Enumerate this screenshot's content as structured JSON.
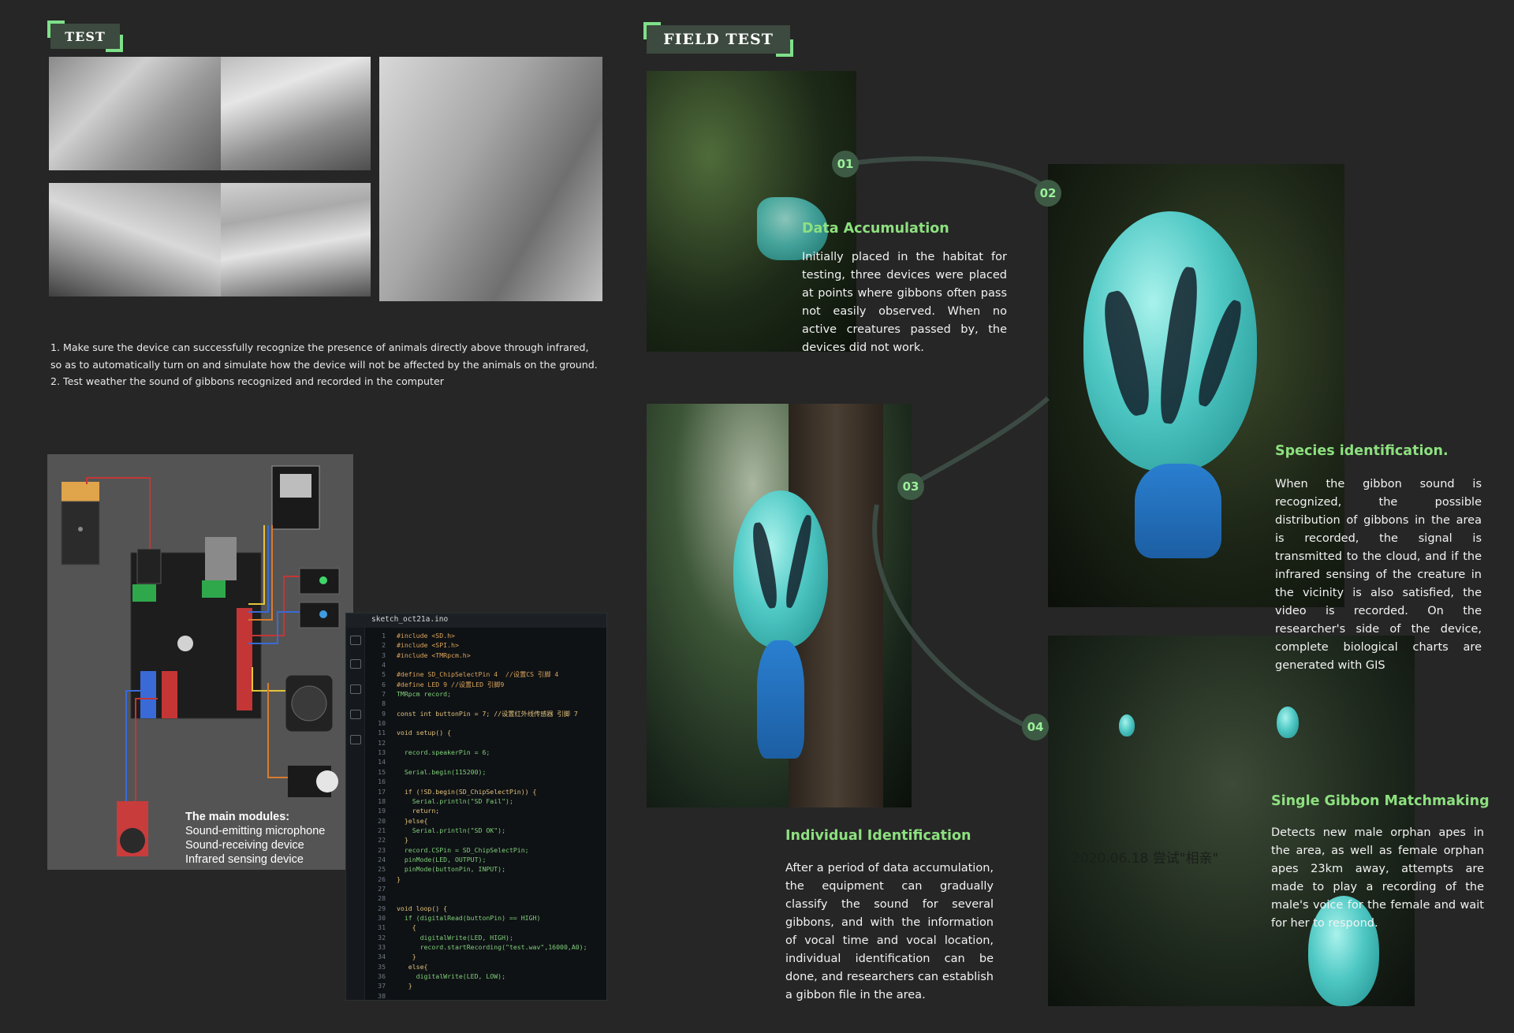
{
  "test_section": {
    "tag": "TEST",
    "notes": [
      "1. Make sure the device can successfully recognize the presence of animals directly above through infrared, so as to automatically turn on and simulate how the device will not be affected by the animals on the ground.",
      "2. Test weather the sound of gibbons recognized and recorded in the computer"
    ],
    "modules_title": "The main modules:",
    "modules": [
      "Sound-emitting microphone",
      "Sound-receiving device",
      "Infrared sensing device"
    ]
  },
  "code_editor": {
    "filename": "sketch_oct21a.ino",
    "lines": [
      {
        "n": "1",
        "t": "#include <SD.h>"
      },
      {
        "n": "2",
        "t": "#include <SPI.h>"
      },
      {
        "n": "3",
        "t": "#include <TMRpcm.h>"
      },
      {
        "n": "4",
        "t": ""
      },
      {
        "n": "5",
        "t": "#define SD_ChipSelectPin 4  //设置CS 引脚 4"
      },
      {
        "n": "6",
        "t": "#define LED 9 //设置LED 引脚9"
      },
      {
        "n": "7",
        "t": "TMRpcm record;"
      },
      {
        "n": "8",
        "t": ""
      },
      {
        "n": "9",
        "t": "const int buttonPin = 7; //设置红外线传感器 引脚 7"
      },
      {
        "n": "10",
        "t": ""
      },
      {
        "n": "11",
        "t": "void setup() {"
      },
      {
        "n": "12",
        "t": ""
      },
      {
        "n": "13",
        "t": "  record.speakerPin = 6;"
      },
      {
        "n": "14",
        "t": ""
      },
      {
        "n": "15",
        "t": "  Serial.begin(115200);"
      },
      {
        "n": "16",
        "t": ""
      },
      {
        "n": "17",
        "t": "  if (!SD.begin(SD_ChipSelectPin)) {"
      },
      {
        "n": "18",
        "t": "    Serial.println(\"SD Fail\");"
      },
      {
        "n": "19",
        "t": "    return;"
      },
      {
        "n": "20",
        "t": "  }else{"
      },
      {
        "n": "21",
        "t": "    Serial.println(\"SD OK\");"
      },
      {
        "n": "22",
        "t": "  }"
      },
      {
        "n": "23",
        "t": "  record.CSPin = SD_ChipSelectPin;"
      },
      {
        "n": "24",
        "t": "  pinMode(LED, OUTPUT);"
      },
      {
        "n": "25",
        "t": "  pinMode(buttonPin, INPUT);"
      },
      {
        "n": "26",
        "t": "}"
      },
      {
        "n": "27",
        "t": ""
      },
      {
        "n": "28",
        "t": ""
      },
      {
        "n": "29",
        "t": "void loop() {"
      },
      {
        "n": "30",
        "t": "  if (digitalRead(buttonPin) == HIGH)"
      },
      {
        "n": "31",
        "t": "    {"
      },
      {
        "n": "32",
        "t": "      digitalWrite(LED, HIGH);"
      },
      {
        "n": "33",
        "t": "      record.startRecording(\"test.wav\",16000,A0);"
      },
      {
        "n": "34",
        "t": "    }"
      },
      {
        "n": "35",
        "t": "   else{"
      },
      {
        "n": "36",
        "t": "     digitalWrite(LED, LOW);"
      },
      {
        "n": "37",
        "t": "   }"
      },
      {
        "n": "38",
        "t": ""
      }
    ]
  },
  "field_test": {
    "tag": "FIELD TEST",
    "steps": [
      {
        "num": "01",
        "title": "Data Accumulation",
        "body": "Initially placed in the habitat for testing, three devices were placed at points where gibbons often pass not easily observed. When no active creatures passed by, the devices did not work."
      },
      {
        "num": "02",
        "title": "Species identification.",
        "body": "When the gibbon sound is recognized, the possible distribution of gibbons in the area is recorded, the signal is transmitted to the cloud, and if the infrared sensing of the creature in the vicinity is also satisfied, the video is recorded. On the researcher's side of the device, complete biological charts are generated with GIS"
      },
      {
        "num": "03",
        "title": "Individual Identification",
        "body": "After a period of data accumulation, the equipment can gradually classify the sound for several gibbons, and with the information of vocal time and vocal location, individual identification can be done, and researchers can establish a gibbon file in the area."
      },
      {
        "num": "04",
        "title": "Single Gibbon Matchmaking",
        "body": "Detects new male orphan apes in the area, as well as female orphan apes 23km away, attempts are made to play a recording of the male's voice for the female and wait for her to respond."
      }
    ],
    "photo_caption": "2020.06.18 尝试\"相亲\""
  },
  "colors": {
    "background": "#262626",
    "accent_green": "#8de07f",
    "tag_bg": "#3d4a3f",
    "connector": "#3c4a44"
  }
}
